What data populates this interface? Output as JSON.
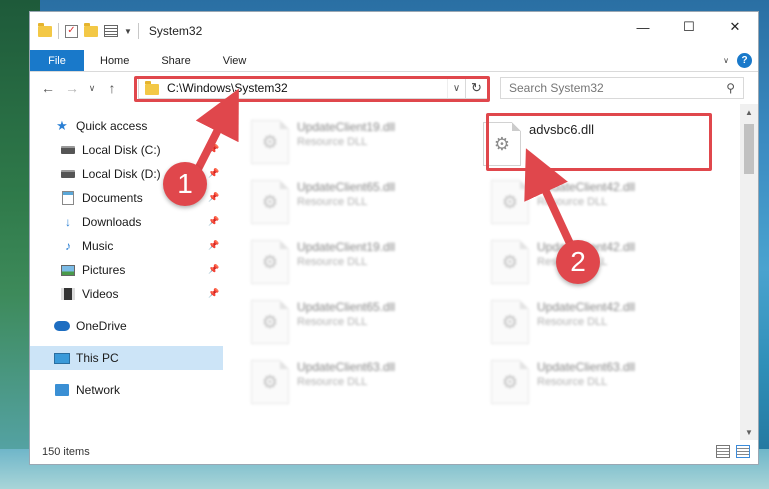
{
  "window": {
    "title": "System32",
    "controls": {
      "minimize": "—",
      "maximize": "☐",
      "close": "✕"
    }
  },
  "ribbon": {
    "file_tab": "File",
    "tabs": [
      "Home",
      "Share",
      "View"
    ]
  },
  "navbar": {
    "address": "C:\\Windows\\System32",
    "search_placeholder": "Search System32"
  },
  "sidebar": {
    "quick_access": "Quick access",
    "items": [
      {
        "label": "Local Disk (C:)",
        "icon": "drive-icon",
        "pinned": true
      },
      {
        "label": "Local Disk (D:)",
        "icon": "drive-icon",
        "pinned": true
      },
      {
        "label": "Documents",
        "icon": "documents-icon",
        "pinned": true
      },
      {
        "label": "Downloads",
        "icon": "download-icon",
        "pinned": true
      },
      {
        "label": "Music",
        "icon": "music-icon",
        "pinned": true
      },
      {
        "label": "Pictures",
        "icon": "pictures-icon",
        "pinned": true
      },
      {
        "label": "Videos",
        "icon": "videos-icon",
        "pinned": true
      }
    ],
    "onedrive": "OneDrive",
    "this_pc": "This PC",
    "network": "Network"
  },
  "files": {
    "target": {
      "name": "advsbc6.dll"
    },
    "blurred": [
      {
        "name": "UpdateClient19.dll",
        "type": "Resource DLL"
      },
      {
        "name": "UpdateClient65.dll",
        "type": "Resource DLL"
      },
      {
        "name": "UpdateClient42.dll",
        "type": "Resource DLL"
      },
      {
        "name": "UpdateClient19.dll",
        "type": "Resource DLL"
      },
      {
        "name": "UpdateClient42.dll",
        "type": "Resource DLL"
      },
      {
        "name": "UpdateClient65.dll",
        "type": "Resource DLL"
      },
      {
        "name": "UpdateClient42.dll",
        "type": "Resource DLL"
      },
      {
        "name": "UpdateClient63.dll",
        "type": "Resource DLL"
      },
      {
        "name": "UpdateClient63.dll",
        "type": "Resource DLL"
      }
    ]
  },
  "status": {
    "items_count": "150 items"
  },
  "annotations": {
    "step1": "1",
    "step2": "2",
    "color": "#e0474c"
  },
  "colors": {
    "accent": "#1979ca",
    "selection": "#cce4f7",
    "annotation": "#e0474c"
  }
}
